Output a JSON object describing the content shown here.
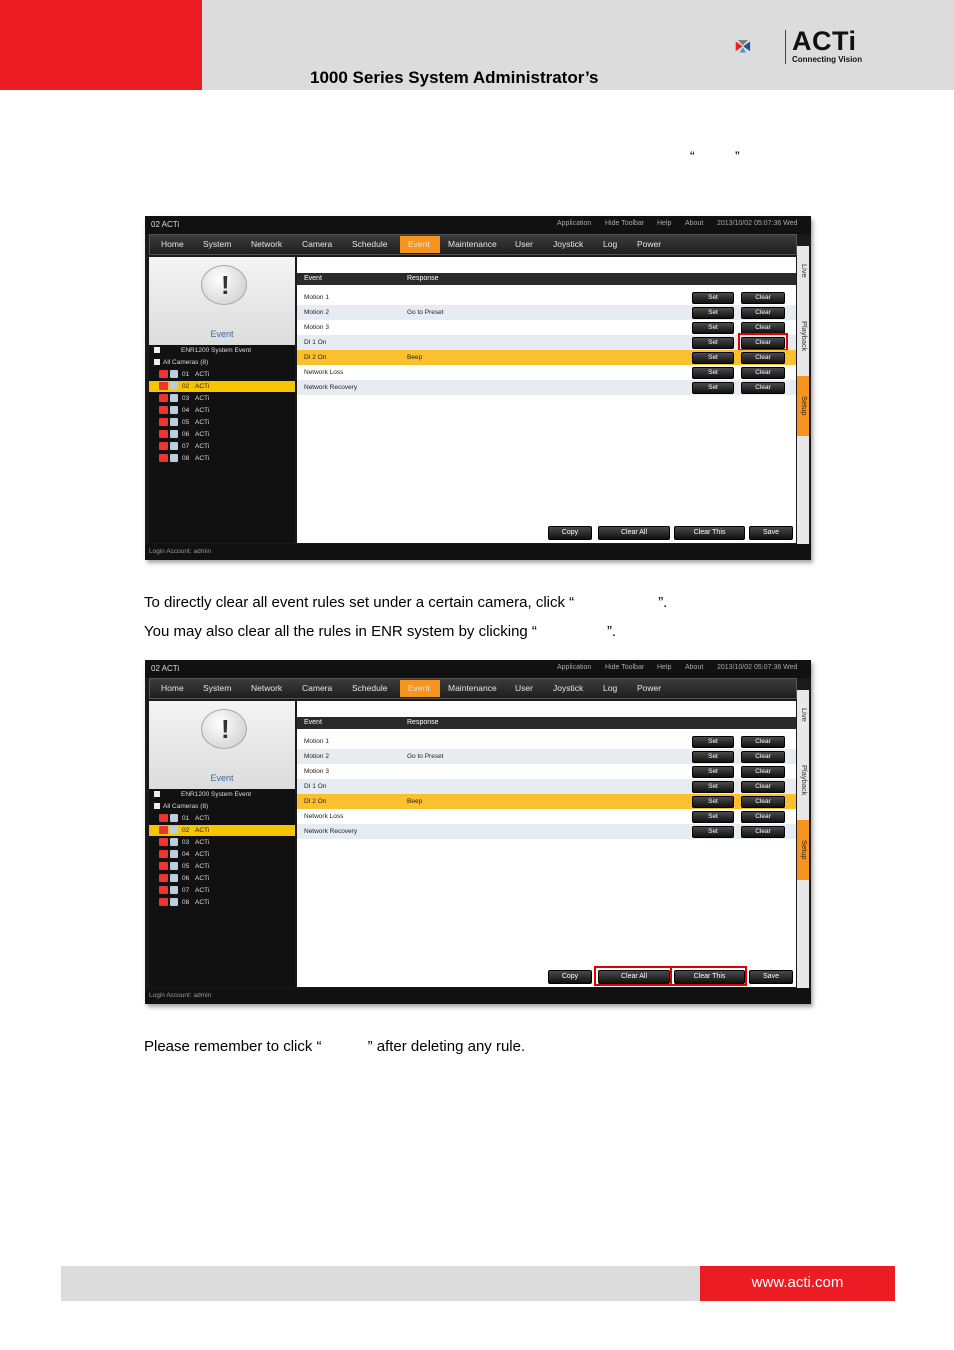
{
  "header": {
    "title": "1000 Series System Administrator’s",
    "logo_name": "ACTi",
    "logo_tagline": "Connecting Vision"
  },
  "top_quotes": {
    "open": "“",
    "close": "”"
  },
  "paragraphs": {
    "p1a": "To directly clear all event rules set under a certain camera, click “",
    "p1b": "”.",
    "p2a": "You may also clear all the rules in ENR system by clicking “",
    "p2b": "”.",
    "p3a": "Please remember to click “",
    "p3b": "” after deleting any rule."
  },
  "screenshot": {
    "window_title": "02 ACTi",
    "title_menu": [
      "Application",
      "Hide Toolbar",
      "Help",
      "About",
      "2013/10/02 05:07:36 Wed"
    ],
    "nav": [
      "Home",
      "System",
      "Network",
      "Camera",
      "Schedule",
      "Event",
      "Maintenance",
      "User",
      "Joystick",
      "Log",
      "Power"
    ],
    "active_nav": "Event",
    "side_tabs": [
      "Live",
      "Playback",
      "Setup"
    ],
    "panel_label": "Event",
    "tree": {
      "system_event": "ENR1200 System Event",
      "all_cameras": "All Cameras (8)",
      "cameras": [
        {
          "num": "01",
          "name": "ACTi"
        },
        {
          "num": "02",
          "name": "ACTi"
        },
        {
          "num": "03",
          "name": "ACTi"
        },
        {
          "num": "04",
          "name": "ACTi"
        },
        {
          "num": "05",
          "name": "ACTi"
        },
        {
          "num": "06",
          "name": "ACTi"
        },
        {
          "num": "07",
          "name": "ACTi"
        },
        {
          "num": "08",
          "name": "ACTi"
        }
      ]
    },
    "table_headers": {
      "event": "Event",
      "response": "Response"
    },
    "rows": [
      {
        "event": "Motion 1",
        "response": ""
      },
      {
        "event": "Motion 2",
        "response": "Go to Preset"
      },
      {
        "event": "Motion 3",
        "response": ""
      },
      {
        "event": "DI 1 On",
        "response": ""
      },
      {
        "event": "DI 2 On",
        "response": "Beep"
      },
      {
        "event": "Network Loss",
        "response": ""
      },
      {
        "event": "Network Recovery",
        "response": ""
      }
    ],
    "row_buttons": {
      "set": "Set",
      "clear": "Clear"
    },
    "bottom_buttons": {
      "copy": "Copy",
      "clear_all": "Clear All",
      "clear_this": "Clear This",
      "save": "Save"
    },
    "status": "Login Account: admin"
  },
  "footer": {
    "url": "www.acti.com"
  },
  "colors": {
    "brand_red": "#ec1c24",
    "accent_orange": "#f7941d",
    "highlight_yellow": "#fbc02d"
  }
}
